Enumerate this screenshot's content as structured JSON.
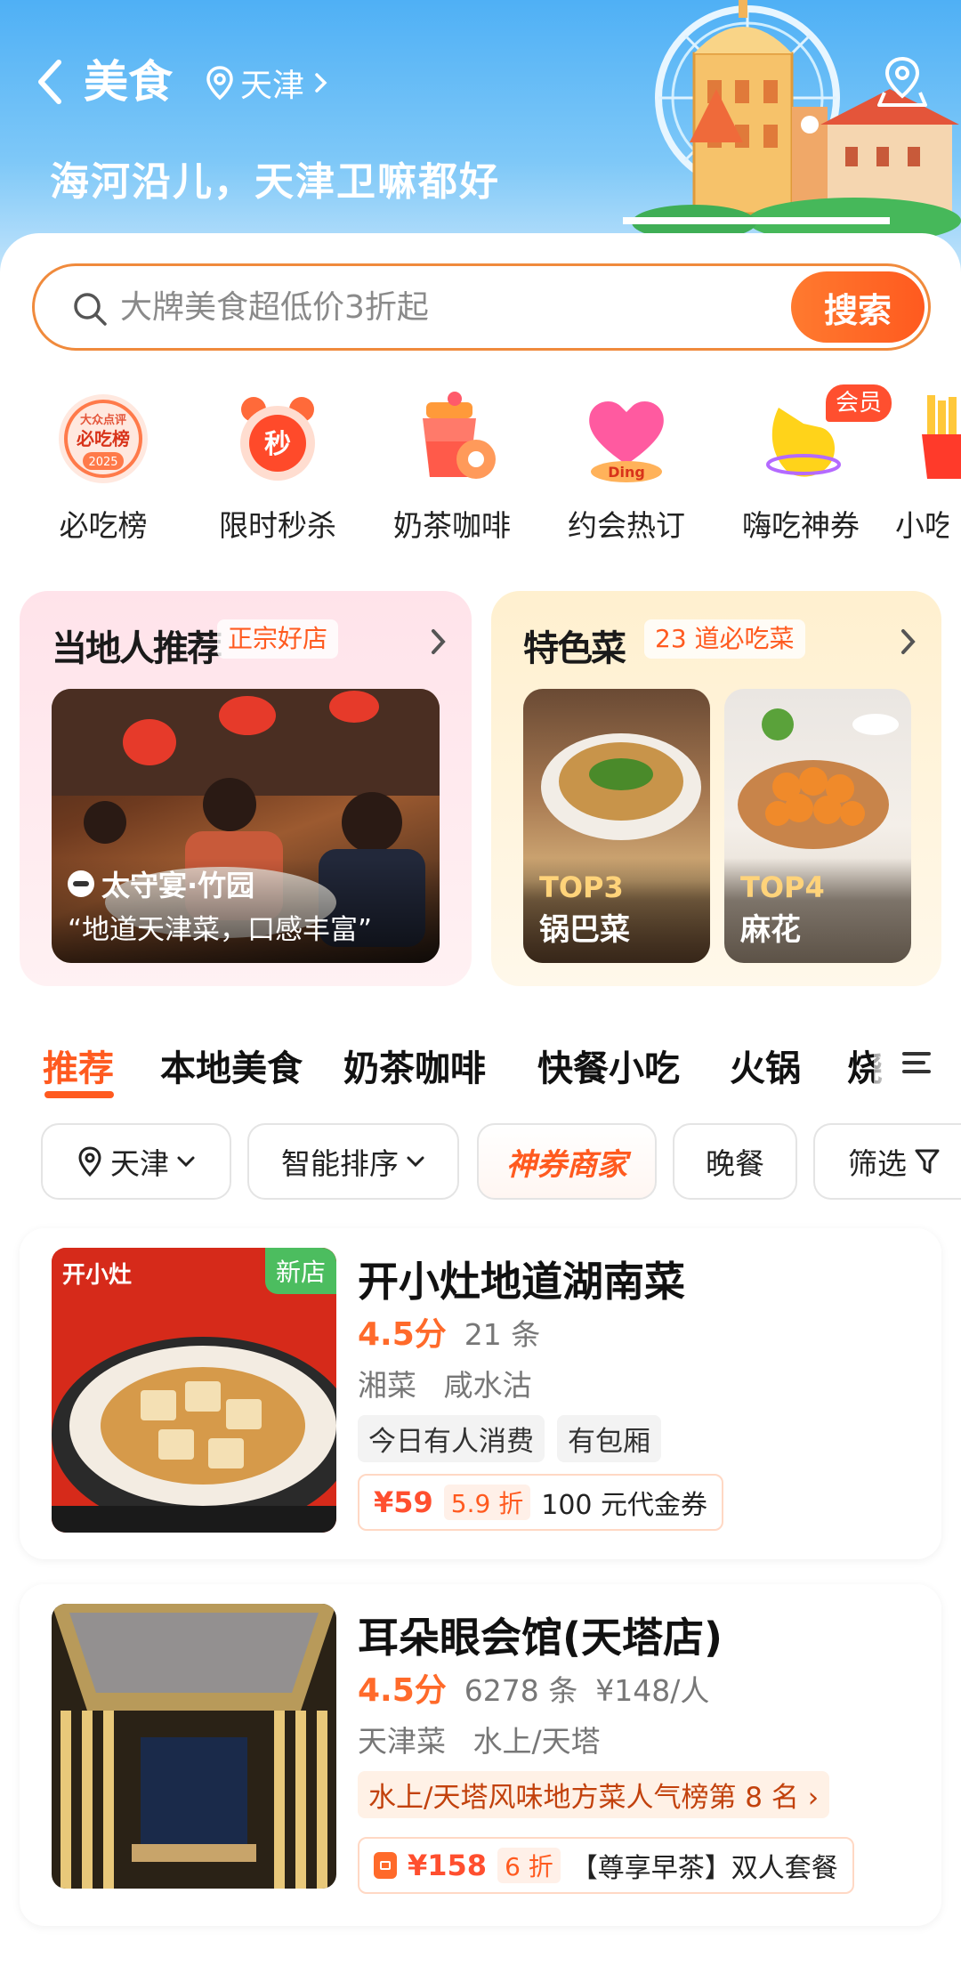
{
  "header": {
    "title": "美食",
    "city": "天津",
    "slogan": "海河沿儿，天津卫嘛都好"
  },
  "search": {
    "placeholder": "大牌美食超低价3折起",
    "button_label": "搜索"
  },
  "quick_categories": [
    {
      "label": "必吃榜",
      "icon": "must-eat-list-icon",
      "badge_text": [
        "大众点评",
        "必吃榜",
        "2025"
      ]
    },
    {
      "label": "限时秒杀",
      "icon": "flash-sale-clock-icon",
      "badge_text": [
        "秒"
      ]
    },
    {
      "label": "奶茶咖啡",
      "icon": "milk-tea-icon"
    },
    {
      "label": "约会热订",
      "icon": "heart-date-icon",
      "badge_text": [
        "Ding"
      ]
    },
    {
      "label": "嗨吃神券",
      "icon": "coupon-hand-icon",
      "badge": "会员"
    },
    {
      "label": "小吃",
      "icon": "fries-icon"
    }
  ],
  "recommend": {
    "local": {
      "title": "当地人推荐",
      "tag": "正宗好店",
      "venue": "太守宴·竹园",
      "quote": "“地道天津菜，口感丰富”"
    },
    "dishes": {
      "title": "特色菜",
      "tag": "23 道必吃菜",
      "items": [
        {
          "rank": "TOP3",
          "name": "锅巴菜"
        },
        {
          "rank": "TOP4",
          "name": "麻花"
        }
      ]
    }
  },
  "tabs": [
    "推荐",
    "本地美食",
    "奶茶咖啡",
    "快餐小吃",
    "火锅",
    "烧"
  ],
  "filters": {
    "city": "天津",
    "sort": "智能排序",
    "voucher": "神券商家",
    "meal": "晚餐",
    "filter": "筛选"
  },
  "listings": [
    {
      "name": "开小灶地道湖南菜",
      "badge": "新店",
      "photo_brand": "开小灶",
      "score": "4.5分",
      "reviews": "21 条",
      "categories": [
        "湘菜",
        "咸水沽"
      ],
      "tags": [
        "今日有人消费",
        "有包厢"
      ],
      "deal": {
        "price": "¥59",
        "discount": "5.9 折",
        "text": "100 元代金券"
      }
    },
    {
      "name": "耳朵眼会馆(天塔店)",
      "score": "4.5分",
      "reviews": "6278 条",
      "avg_price": "¥148/人",
      "categories": [
        "天津菜",
        "水上/天塔"
      ],
      "rank_text": "水上/天塔风味地方菜人气榜第 8 名",
      "deal": {
        "price": "¥158",
        "discount": "6 折",
        "text": "【尊享早茶】双人套餐"
      }
    }
  ],
  "colors": {
    "accent": "#ff5a1f",
    "header_blue": "#4fb0f5",
    "score": "#ff6a2a",
    "new_badge": "#4cbd5f"
  }
}
